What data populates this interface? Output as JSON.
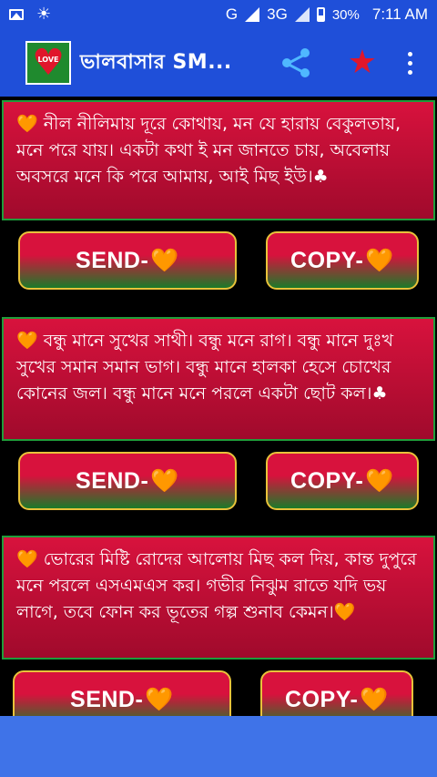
{
  "status_bar": {
    "network": "G",
    "network2": "3G",
    "battery": "30%",
    "time": "7:11 AM",
    "icons": [
      "picture-icon",
      "brightness-icon",
      "signal-icon",
      "battery-icon"
    ]
  },
  "app_bar": {
    "title": "ভালবাসার SM...",
    "logo_text": "LOVE",
    "icons": [
      "share-icon",
      "star-icon",
      "overflow-menu-icon"
    ],
    "accent_color": "#1f4fd9"
  },
  "messages": [
    {
      "text": "🧡 নীল নীলিমায় দূরে কোথায়, মন যে হারায় বেকুলতায়, মনে পরে যায়। একটা কথা ই মন জানতে চায়, অবেলায় অবসরে মনে কি পরে আমায়, আই মিছ ইউ।♣",
      "send_label": "SEND-",
      "copy_label": "COPY-",
      "heart": "🧡"
    },
    {
      "text": "🧡 বন্ধু মানে সুখের সাথী। বন্ধু মনে রাগ। বন্ধু মানে দুঃখ সুখের সমান সমান ভাগ। বন্ধু মানে হালকা হেসে চোখের কোনের জল। বন্ধু মানে মনে পরলে একটা ছোট কল।♣",
      "send_label": "SEND-",
      "copy_label": "COPY-",
      "heart": "🧡"
    },
    {
      "text": "🧡 ভোরের মিষ্টি রোদের আলোয় মিছ কল দিয়, কান্ত দুপুরে মনে পরলে এসএমএস কর। গভীর নিঝুম রাতে যদি ভয় লাগে, তবে ফোন কর ভূতের গল্প শুনাব কেমন।🧡",
      "send_label": "SEND-",
      "copy_label": "COPY-",
      "heart": "🧡"
    }
  ],
  "colors": {
    "card_red": "#d8123d",
    "card_border": "#1f9d3a",
    "button_border": "#e8c23a",
    "bottom_bar": "#3f73e8"
  }
}
